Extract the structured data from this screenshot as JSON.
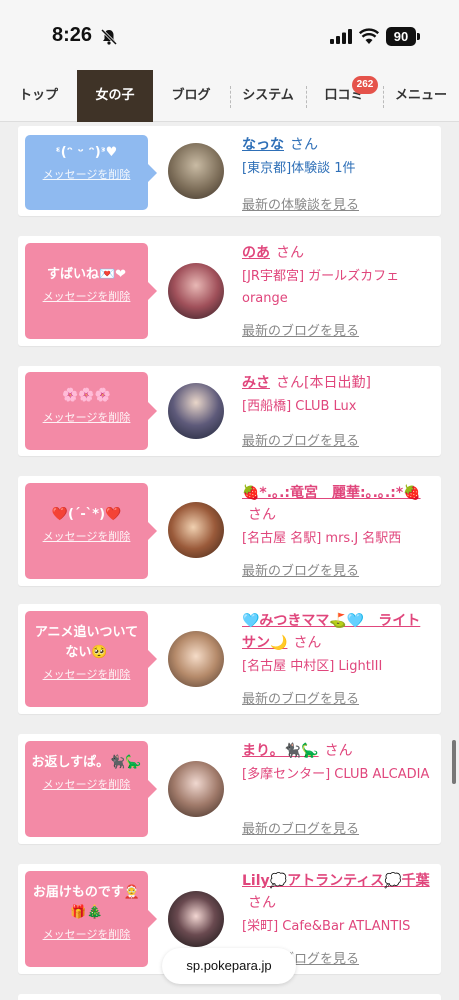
{
  "status_bar": {
    "time": "8:26",
    "battery": "90"
  },
  "nav": {
    "tabs": [
      {
        "label": "トップ"
      },
      {
        "label": "女の子"
      },
      {
        "label": "ブログ"
      },
      {
        "label": "システム"
      },
      {
        "label": "口コミ"
      },
      {
        "label": "メニュー"
      }
    ],
    "reviews_badge": "262"
  },
  "colors": {
    "pink": "#f38aa6",
    "blue": "#8fbaf0",
    "pink_text": "#e0467c",
    "blue_text": "#2e6fb7"
  },
  "entries": [
    {
      "message": "ᵋ(ᵔ ᵕ ᵔ)ᵌ♥",
      "delete_label": "メッセージを削除",
      "name": "なっな",
      "name_extra": "",
      "honorific": "さん",
      "shop": "[東京都]体験談 1件",
      "more_link": "最新の体験談を見る",
      "theme": "blue"
    },
    {
      "message": "すばいね💌❤",
      "delete_label": "メッセージを削除",
      "name": "のあ",
      "name_extra": "",
      "honorific": "さん",
      "shop": "[JR宇都宮] ガールズカフェorange",
      "more_link": "最新のブログを見る",
      "theme": "pink"
    },
    {
      "message": "🌸🌸🌸",
      "delete_label": "メッセージを削除",
      "name": "みさ",
      "name_extra": "[本日出勤]",
      "honorific": "さん",
      "shop": "[西船橋] CLUB Lux",
      "more_link": "最新のブログを見る",
      "theme": "pink"
    },
    {
      "message": "❤️(´-`*)❤️",
      "delete_label": "メッセージを削除",
      "name": "🍓*.｡.:竜宮　麗華:｡.｡.:*🍓",
      "name_extra": "",
      "honorific": "さん",
      "shop": "[名古屋 名駅] mrs.J 名駅西",
      "more_link": "最新のブログを見る",
      "theme": "pink"
    },
    {
      "message": "アニメ追いついてない🥺",
      "delete_label": "メッセージを削除",
      "name": "🩵みつきママ⛳🩵　ライトサン🌙",
      "name_extra": "",
      "honorific": "さん",
      "shop": "[名古屋 中村区] LightIII",
      "more_link": "最新のブログを見る",
      "theme": "pink"
    },
    {
      "message": "お返しすぱ。🐈‍⬛🦕",
      "delete_label": "メッセージを削除",
      "name": "まり。🐈‍⬛🦕",
      "name_extra": "",
      "honorific": "さん",
      "shop": "[多摩センター] CLUB ALCADIA",
      "more_link": "最新のブログを見る",
      "theme": "pink"
    },
    {
      "message": "お届けものです🤶🎁🎄",
      "delete_label": "メッセージを削除",
      "name": "Lily💭アトランティス💭千葉",
      "name_extra": "",
      "honorific": "さん",
      "shop": "[栄町] Cafe&Bar ATLANTIS",
      "more_link": "最新のブログを見る",
      "theme": "pink"
    }
  ],
  "browser": {
    "url": "sp.pokepara.jp"
  }
}
